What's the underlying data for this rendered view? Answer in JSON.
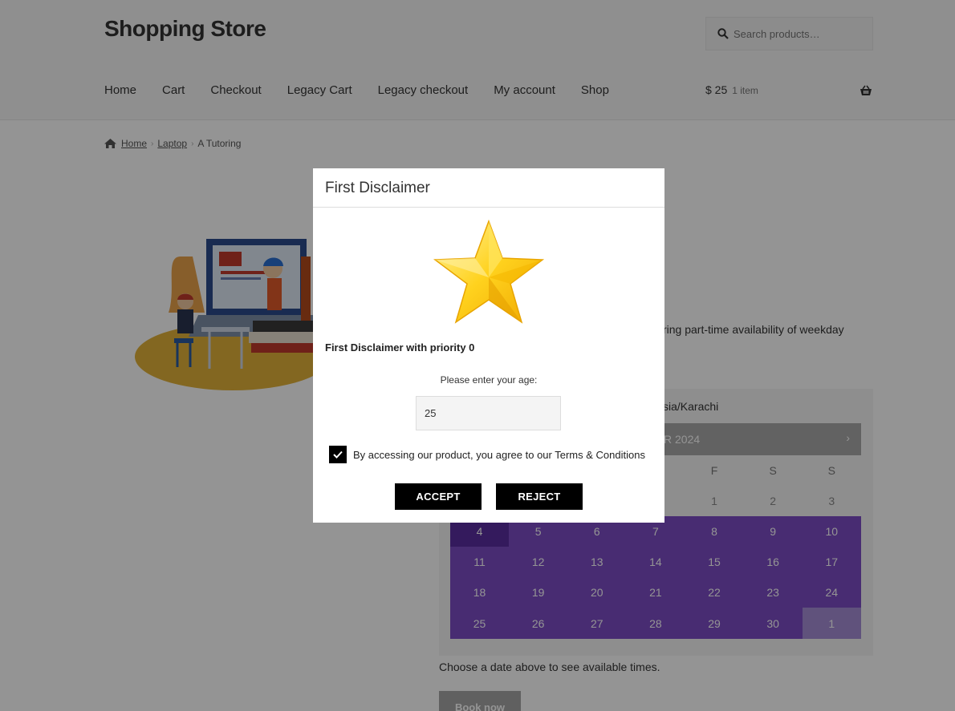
{
  "header": {
    "site_title": "Shopping Store",
    "search_placeholder": "Search products…",
    "nav": [
      "Home",
      "Cart",
      "Checkout",
      "Legacy Cart",
      "Legacy checkout",
      "My account",
      "Shop"
    ],
    "cart_amount": "$ 25",
    "cart_count": "1 item"
  },
  "breadcrumb": {
    "home": "Home",
    "category": "Laptop",
    "current": "A Tutoring"
  },
  "product": {
    "description_fragment": "ring part-time availability of weekday",
    "timezone_fragment": "sia/Karachi"
  },
  "calendar": {
    "title_fragment": "R 2024",
    "next_label": "›",
    "weekdays_visible": [
      "F",
      "S",
      "S"
    ],
    "first_row_visible": [
      "1",
      "2",
      "3"
    ],
    "weeks": [
      [
        "4",
        "5",
        "6",
        "7",
        "8",
        "9",
        "10"
      ],
      [
        "11",
        "12",
        "13",
        "14",
        "15",
        "16",
        "17"
      ],
      [
        "18",
        "19",
        "20",
        "21",
        "22",
        "23",
        "24"
      ],
      [
        "25",
        "26",
        "27",
        "28",
        "29",
        "30",
        "1"
      ]
    ],
    "choose_text": "Choose a date above to see available times.",
    "book_label": "Book now",
    "colors": {
      "available": "#7c4dc4",
      "today": "#5a2ea0",
      "next_month": "#a58ed6"
    }
  },
  "modal": {
    "title": "First Disclaimer",
    "heading": "First Disclaimer with priority 0",
    "age_label": "Please enter your age:",
    "age_value": "25",
    "agree_text": "By accessing our product, you agree to our Terms & Conditions",
    "accept_label": "ACCEPT",
    "reject_label": "REJECT"
  }
}
